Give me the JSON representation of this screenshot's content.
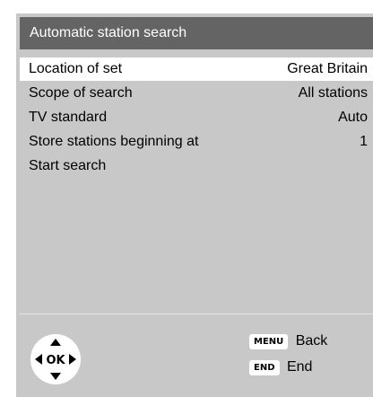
{
  "header": {
    "title": "Automatic station search"
  },
  "menu": {
    "items": [
      {
        "label": "Location of set",
        "value": "Great Britain",
        "selected": true
      },
      {
        "label": "Scope of search",
        "value": "All stations"
      },
      {
        "label": "TV standard",
        "value": "Auto"
      },
      {
        "label": "Store stations beginning at",
        "value": "1"
      },
      {
        "label": "Start search",
        "value": ""
      }
    ]
  },
  "footer": {
    "ok_label": "OK",
    "keys": [
      {
        "key": "MENU",
        "label": "Back"
      },
      {
        "key": "END",
        "label": "End"
      }
    ]
  }
}
